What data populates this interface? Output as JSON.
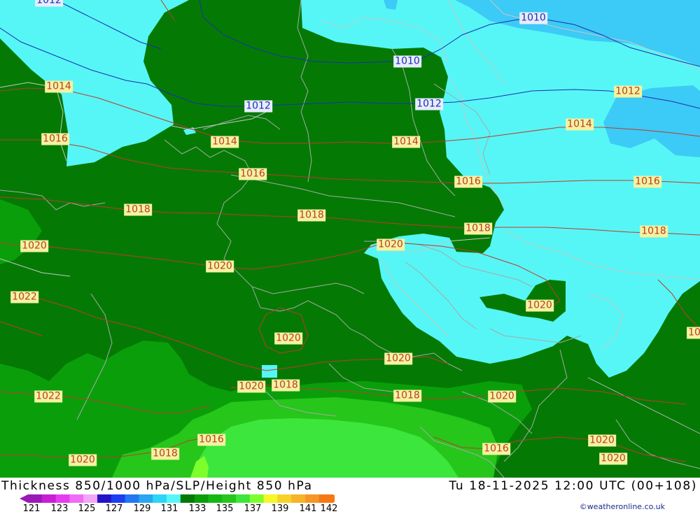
{
  "title": "Thickness 850/1000 hPa/SLP/Height 850 hPa",
  "timestamp": "Tu 18-11-2025 12:00 UTC (00+108)",
  "credit": "©weatheronline.co.uk",
  "colors": {
    "bg_cyan": "#56f6f6",
    "dark_green": "#047a04",
    "mid_green": "#0a9f0a",
    "light_green": "#26c61a",
    "lime": "#3ce63c",
    "bright_lime": "#7dff2b",
    "blue_low": "#3ccaf6",
    "isobar_red": "#c0392b",
    "isobar_blue": "#1c2fb0",
    "border_gray": "#a8a8a8"
  },
  "colorbar": {
    "colors": [
      "#9a1ab8",
      "#c81ed6",
      "#e63cf0",
      "#f06cf6",
      "#f4a6f6",
      "#2314c8",
      "#1e3cf0",
      "#2278f0",
      "#28a6f0",
      "#2cd6f6",
      "#56f6f6",
      "#047a04",
      "#0a9f0a",
      "#14b814",
      "#26c61a",
      "#3ce63c",
      "#7dff2b",
      "#f6f628",
      "#f6d228",
      "#f6b428",
      "#f69628",
      "#f67814"
    ],
    "ticks": [
      "121",
      "123",
      "125",
      "127",
      "129",
      "131",
      "133",
      "135",
      "137",
      "139",
      "141",
      "142"
    ]
  },
  "isobars": [
    {
      "value": "1012",
      "color": "blue"
    },
    {
      "value": "1010",
      "color": "blue"
    },
    {
      "value": "1010",
      "color": "blue"
    },
    {
      "value": "1012",
      "color": "blue"
    },
    {
      "value": "1012",
      "color": "blue"
    },
    {
      "value": "1012",
      "color": "red"
    },
    {
      "value": "1014",
      "color": "red"
    },
    {
      "value": "1014",
      "color": "red"
    },
    {
      "value": "1014",
      "color": "red"
    },
    {
      "value": "1014",
      "color": "red"
    },
    {
      "value": "1016",
      "color": "red"
    },
    {
      "value": "1016",
      "color": "red"
    },
    {
      "value": "1016",
      "color": "red"
    },
    {
      "value": "1016",
      "color": "red"
    },
    {
      "value": "1018",
      "color": "red"
    },
    {
      "value": "1018",
      "color": "red"
    },
    {
      "value": "1018",
      "color": "red"
    },
    {
      "value": "1018",
      "color": "red"
    },
    {
      "value": "1020",
      "color": "red"
    },
    {
      "value": "1020",
      "color": "red"
    },
    {
      "value": "1020",
      "color": "red"
    },
    {
      "value": "1020",
      "color": "red"
    },
    {
      "value": "1022",
      "color": "red"
    },
    {
      "value": "1020",
      "color": "red"
    },
    {
      "value": "1020",
      "color": "red"
    },
    {
      "value": "1020",
      "color": "red"
    },
    {
      "value": "1018",
      "color": "red"
    },
    {
      "value": "1022",
      "color": "red"
    },
    {
      "value": "1018",
      "color": "red"
    },
    {
      "value": "1020",
      "color": "red"
    },
    {
      "value": "1016",
      "color": "red"
    },
    {
      "value": "1018",
      "color": "red"
    },
    {
      "value": "1020",
      "color": "red"
    },
    {
      "value": "1016",
      "color": "red"
    },
    {
      "value": "1020",
      "color": "red"
    },
    {
      "value": "1020",
      "color": "red"
    },
    {
      "value": "10",
      "color": "red"
    }
  ]
}
